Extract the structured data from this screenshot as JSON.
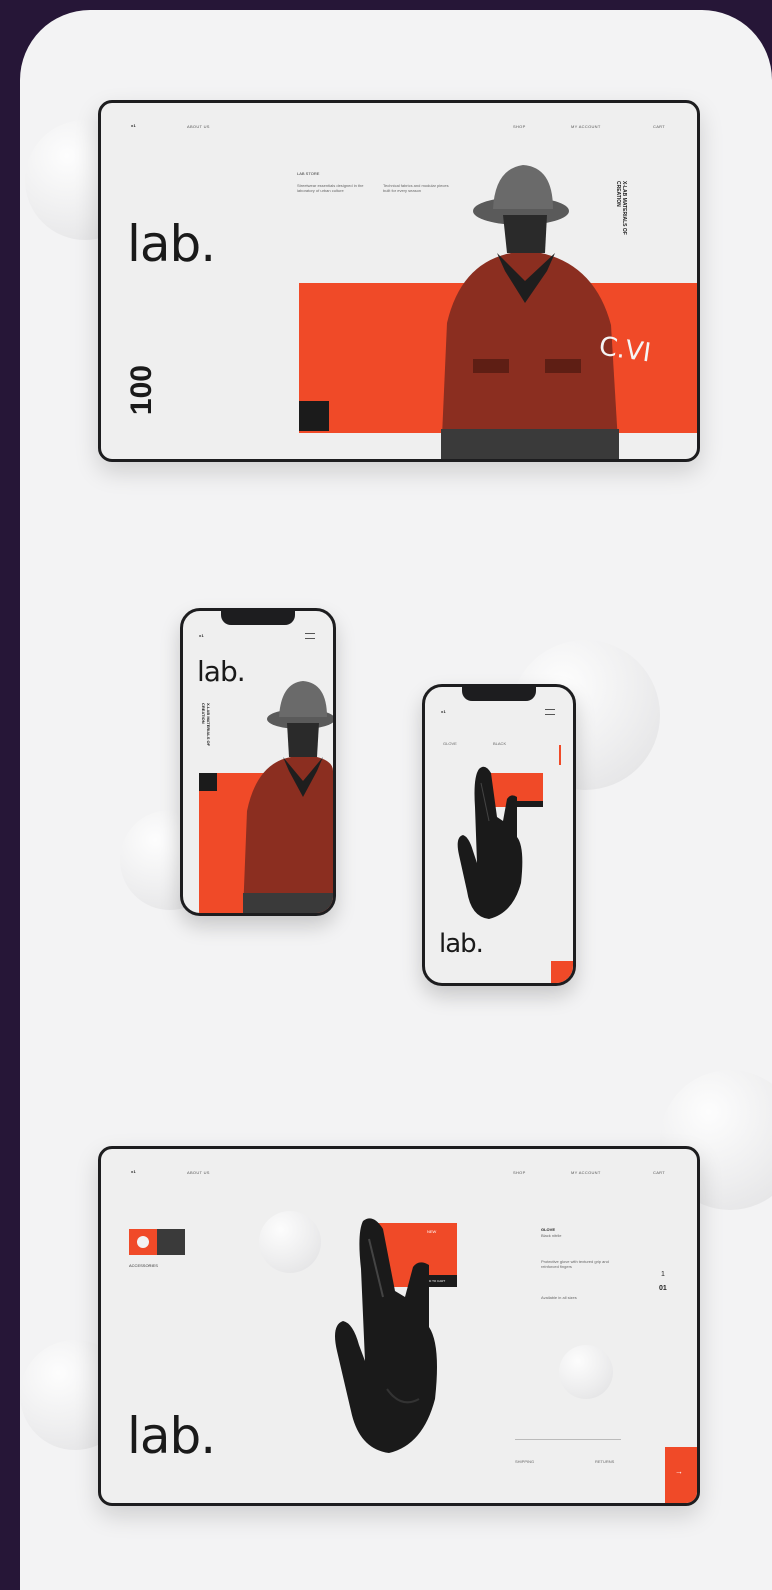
{
  "brand": {
    "wordmark": "lab.",
    "short": "x1"
  },
  "colors": {
    "accent": "#f04a28",
    "ink": "#1b1b1b",
    "frame": "#261637",
    "panel": "#f3f3f4"
  },
  "desktop_hero": {
    "nav": {
      "logo": "x1",
      "menu": "ABOUT US",
      "shop": "SHOP",
      "account": "MY ACCOUNT",
      "cart": "CART"
    },
    "small_heading": "LAB STORE",
    "text_col_1": "Streetwear essentials designed in the laboratory of urban culture",
    "text_col_2": "Technical fabrics and modular pieces built for every season",
    "side_caption": "X-LAB MATERIALS OF CREATION",
    "number": "100",
    "jacket_print": "C.VI"
  },
  "phone_hero": {
    "nav_logo": "x1",
    "side_caption": "X-LAB MATERIALS OF CREATION"
  },
  "phone_product": {
    "nav_logo": "x1",
    "label_1": "GLOVE",
    "label_2": "BLACK"
  },
  "desktop_product": {
    "nav": {
      "logo": "x1",
      "menu": "ABOUT US",
      "shop": "SHOP",
      "account": "MY ACCOUNT",
      "cart": "CART"
    },
    "thumb_caption": "ACCESSORIES",
    "product_title": "GLOVE",
    "product_sub": "Black nitrile",
    "desc_1": "Protective glove with textured grip and reinforced fingers",
    "desc_2": "Available in all sizes",
    "pager_top": "1",
    "pager_bottom": "01",
    "tag_label": "NEW",
    "buy_label": "ADD TO CART",
    "footer_left": "SHIPPING",
    "footer_right": "RETURNS",
    "cta_arrow": "→"
  }
}
